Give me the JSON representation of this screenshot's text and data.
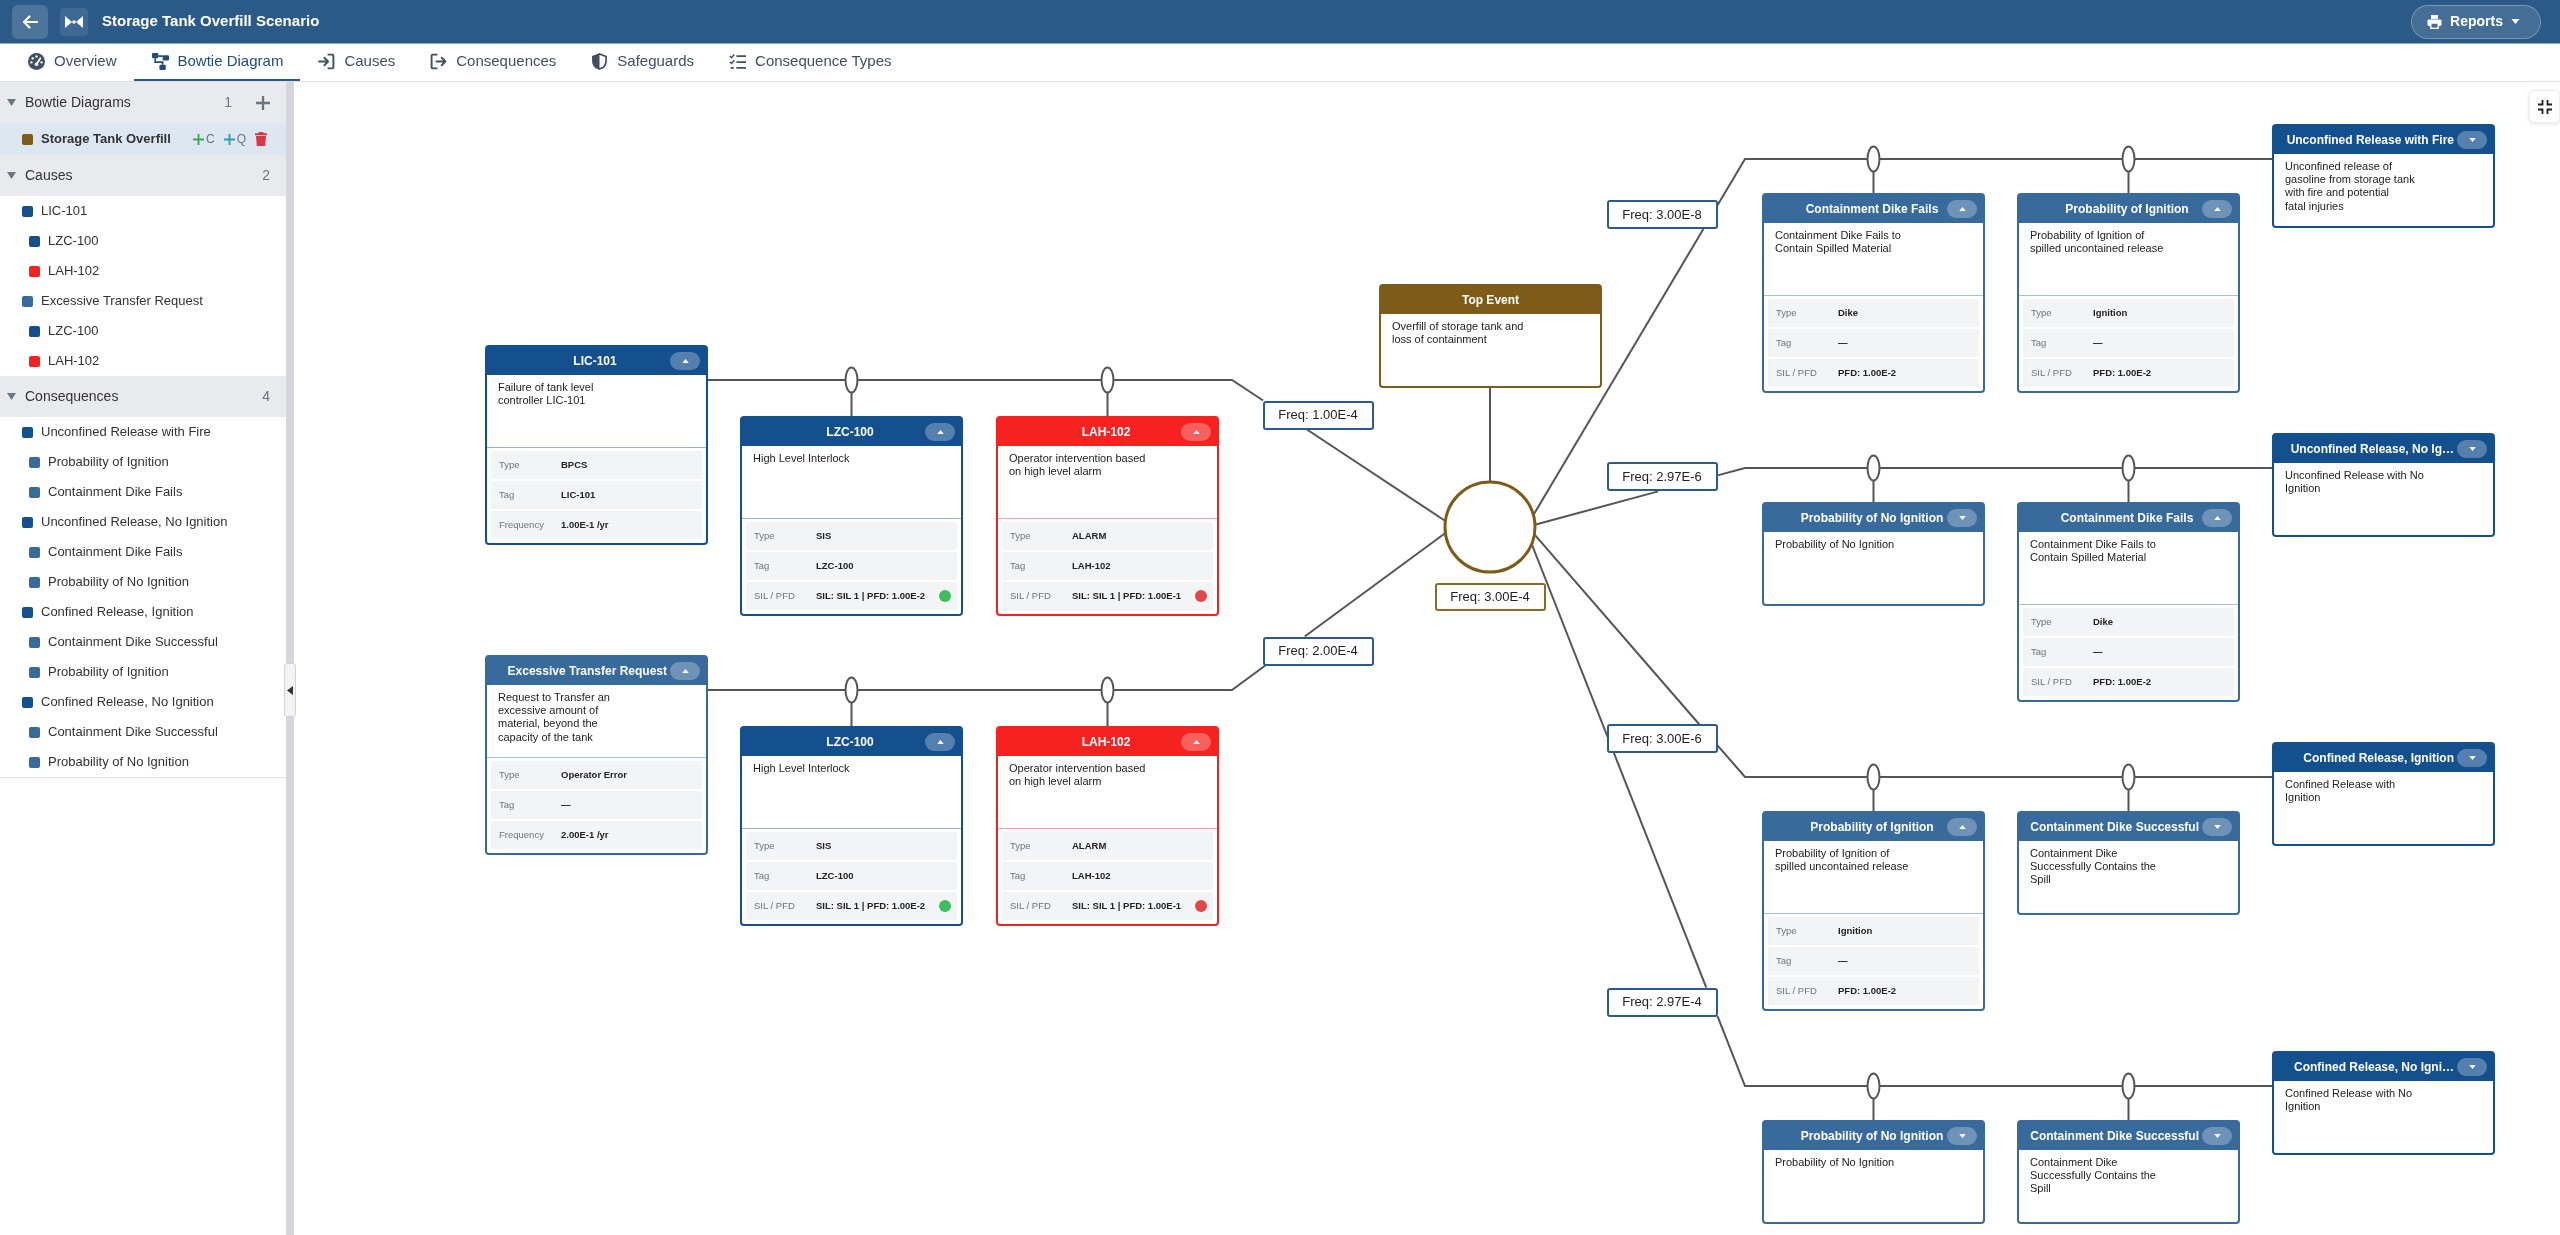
{
  "header": {
    "title": "Storage Tank Overfill Scenario",
    "reports_button": "Reports"
  },
  "tabs": [
    {
      "label": "Overview",
      "selected": false
    },
    {
      "label": "Bowtie Diagram",
      "selected": true
    },
    {
      "label": "Causes",
      "selected": false
    },
    {
      "label": "Consequences",
      "selected": false
    },
    {
      "label": "Safeguards",
      "selected": false
    },
    {
      "label": "Consequence Types",
      "selected": false
    }
  ],
  "sidebar": {
    "sections": [
      {
        "title": "Bowtie Diagrams",
        "count": "1",
        "expanded": true,
        "actions": [
          {
            "kind": "add",
            "color": "#6c757d"
          }
        ],
        "items": [
          {
            "label": "Storage Tank Overfill",
            "color": "#7d5c1a",
            "selected": true,
            "actions": [
              {
                "kind": "add",
                "label": "C",
                "color": "#3ba757"
              },
              {
                "kind": "add",
                "label": "Q",
                "color": "#2a9db2"
              },
              {
                "kind": "delete",
                "color": "#dc3545"
              }
            ]
          }
        ]
      },
      {
        "title": "Causes",
        "count": "2",
        "expanded": true,
        "items": [
          {
            "label": "LIC-101",
            "color": "#14508e",
            "selected": false,
            "children": [
              {
                "label": "LZC-100",
                "color": "#14508e",
                "selected": false
              },
              {
                "label": "LAH-102",
                "color": "#f5221f",
                "selected": false
              }
            ]
          },
          {
            "label": "Excessive Transfer Request",
            "color": "#386a9c",
            "selected": false,
            "children": [
              {
                "label": "LZC-100",
                "color": "#14508e",
                "selected": false
              },
              {
                "label": "LAH-102",
                "color": "#f5221f",
                "selected": false
              }
            ]
          }
        ]
      },
      {
        "title": "Consequences",
        "count": "4",
        "expanded": true,
        "items": [
          {
            "label": "Unconfined Release with Fire",
            "color": "#14508e",
            "selected": false,
            "children": [
              {
                "label": "Probability of Ignition",
                "color": "#386a9c",
                "selected": false
              },
              {
                "label": "Containment Dike Fails",
                "color": "#386a9c",
                "selected": false
              }
            ]
          },
          {
            "label": "Unconfined Release, No Ignition",
            "color": "#14508e",
            "selected": false,
            "children": [
              {
                "label": "Containment Dike Fails",
                "color": "#386a9c",
                "selected": false
              },
              {
                "label": "Probability of No Ignition",
                "color": "#386a9c",
                "selected": false
              }
            ]
          },
          {
            "label": "Confined Release, Ignition",
            "color": "#14508e",
            "selected": false,
            "children": [
              {
                "label": "Containment Dike Successful",
                "color": "#386a9c",
                "selected": false
              },
              {
                "label": "Probability of Ignition",
                "color": "#386a9c",
                "selected": false
              }
            ]
          },
          {
            "label": "Confined Release, No Ignition",
            "color": "#14508e",
            "selected": false,
            "children": [
              {
                "label": "Containment Dike Successful",
                "color": "#386a9c",
                "selected": false
              },
              {
                "label": "Probability of No Ignition",
                "color": "#386a9c",
                "selected": false
              }
            ]
          }
        ]
      }
    ]
  },
  "diagram": {
    "top_event": {
      "title": "Top Event",
      "description": "Overfill of storage tank and\nloss of containment",
      "frequency": "Freq: 3.00E-4"
    },
    "causes": [
      {
        "title": "LIC-101",
        "color": "#14508e",
        "expanded": true,
        "description": "Failure of tank level\ncontroller LIC-101",
        "details": [
          {
            "label": "Type",
            "value": "BPCS"
          },
          {
            "label": "Tag",
            "value": "LIC-101"
          },
          {
            "label": "Frequency",
            "value": "1.00E-1 /yr"
          }
        ],
        "frequency": "Freq: 1.00E-4",
        "barriers": [
          {
            "title": "LZC-100",
            "color": "#14508e",
            "expanded": true,
            "description": "High Level Interlock",
            "details": [
              {
                "label": "Type",
                "value": "SIS"
              },
              {
                "label": "Tag",
                "value": "LZC-100"
              },
              {
                "label": "SIL / PFD",
                "value": "SIL: SIL 1 | PFD: 1.00E-2",
                "color": "#3cbf5e"
              }
            ]
          },
          {
            "title": "LAH-102",
            "color": "#f5221f",
            "expanded": true,
            "description": "Operator intervention based\non high level alarm",
            "details": [
              {
                "label": "Type",
                "value": "ALARM"
              },
              {
                "label": "Tag",
                "value": "LAH-102"
              },
              {
                "label": "SIL / PFD",
                "value": "SIL: SIL 1 | PFD: 1.00E-1",
                "color": "#e0484a"
              }
            ]
          }
        ]
      },
      {
        "title": "Excessive Transfer Request",
        "color": "#386a9c",
        "expanded": true,
        "description": "Request to Transfer an\nexcessive amount of\nmaterial, beyond the\ncapacity of the tank",
        "details": [
          {
            "label": "Type",
            "value": "Operator Error"
          },
          {
            "label": "Tag",
            "value": "—"
          },
          {
            "label": "Frequency",
            "value": "2.00E-1 /yr"
          }
        ],
        "frequency": "Freq: 2.00E-4",
        "barriers": [
          {
            "title": "LZC-100",
            "color": "#14508e",
            "expanded": true,
            "description": "High Level Interlock",
            "details": [
              {
                "label": "Type",
                "value": "SIS"
              },
              {
                "label": "Tag",
                "value": "LZC-100"
              },
              {
                "label": "SIL / PFD",
                "value": "SIL: SIL 1 | PFD: 1.00E-2",
                "color": "#3cbf5e"
              }
            ]
          },
          {
            "title": "LAH-102",
            "color": "#f5221f",
            "expanded": true,
            "description": "Operator intervention based\non high level alarm",
            "details": [
              {
                "label": "Type",
                "value": "ALARM"
              },
              {
                "label": "Tag",
                "value": "LAH-102"
              },
              {
                "label": "SIL / PFD",
                "value": "SIL: SIL 1 | PFD: 1.00E-1",
                "color": "#e0484a"
              }
            ]
          }
        ]
      }
    ],
    "consequences": [
      {
        "title": "Unconfined Release with Fire",
        "color": "#14508e",
        "expanded": false,
        "description": "Unconfined release of\ngasoline from storage tank\nwith fire and potential\nfatal injuries",
        "frequency": "Freq: 3.00E-8",
        "barriers": [
          {
            "title": "Containment Dike Fails",
            "color": "#386a9c",
            "expanded": true,
            "description": "Containment Dike Fails to\nContain Spilled Material",
            "details": [
              {
                "label": "Type",
                "value": "Dike"
              },
              {
                "label": "Tag",
                "value": "—"
              },
              {
                "label": "SIL / PFD",
                "value": "PFD: 1.00E-2"
              }
            ]
          },
          {
            "title": "Probability of Ignition",
            "color": "#386a9c",
            "expanded": true,
            "description": "Probability of Ignition of\nspilled uncontained release",
            "details": [
              {
                "label": "Type",
                "value": "Ignition"
              },
              {
                "label": "Tag",
                "value": "—"
              },
              {
                "label": "SIL / PFD",
                "value": "PFD: 1.00E-2"
              }
            ]
          }
        ]
      },
      {
        "title": "Unconfined Release, No Ig…",
        "color": "#14508e",
        "expanded": false,
        "description": "Unconfined Release with No\nIgnition",
        "frequency": "Freq: 2.97E-6",
        "barriers": [
          {
            "title": "Probability of No Ignition",
            "color": "#386a9c",
            "expanded": false,
            "description": "Probability of No Ignition"
          },
          {
            "title": "Containment Dike Fails",
            "color": "#386a9c",
            "expanded": true,
            "description": "Containment Dike Fails to\nContain Spilled Material",
            "details": [
              {
                "label": "Type",
                "value": "Dike"
              },
              {
                "label": "Tag",
                "value": "—"
              },
              {
                "label": "SIL / PFD",
                "value": "PFD: 1.00E-2"
              }
            ]
          }
        ]
      },
      {
        "title": "Confined Release, Ignition",
        "color": "#14508e",
        "expanded": false,
        "description": "Confined Release with\nIgnition",
        "frequency": "Freq: 3.00E-6",
        "barriers": [
          {
            "title": "Probability of Ignition",
            "color": "#386a9c",
            "expanded": true,
            "description": "Probability of Ignition of\nspilled uncontained release",
            "details": [
              {
                "label": "Type",
                "value": "Ignition"
              },
              {
                "label": "Tag",
                "value": "—"
              },
              {
                "label": "SIL / PFD",
                "value": "PFD: 1.00E-2"
              }
            ]
          },
          {
            "title": "Containment Dike Successful",
            "color": "#386a9c",
            "expanded": false,
            "description": "Containment Dike\nSuccessfully Contains the\nSpill"
          }
        ]
      },
      {
        "title": "Confined Release, No Igni…",
        "color": "#14508e",
        "expanded": false,
        "description": "Confined Release with No\nIgnition",
        "frequency": "Freq: 2.97E-4",
        "barriers": [
          {
            "title": "Probability of No Ignition",
            "color": "#386a9c",
            "expanded": false,
            "description": "Probability of No Ignition"
          },
          {
            "title": "Containment Dike Successful",
            "color": "#386a9c",
            "expanded": false,
            "description": "Containment Dike\nSuccessfully Contains the\nSpill"
          }
        ]
      }
    ]
  }
}
